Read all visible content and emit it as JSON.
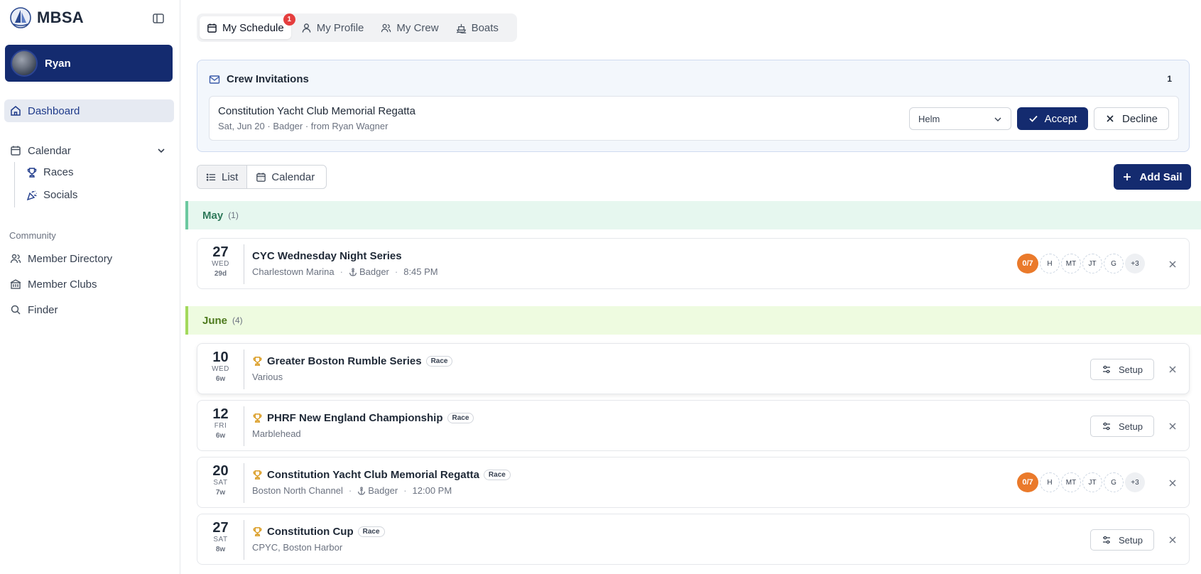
{
  "brand": {
    "name": "MBSA"
  },
  "user": {
    "name": "Ryan"
  },
  "sidebar": {
    "dashboard": "Dashboard",
    "calendar": "Calendar",
    "races": "Races",
    "socials": "Socials",
    "community_label": "Community",
    "member_directory": "Member Directory",
    "member_clubs": "Member Clubs",
    "finder": "Finder"
  },
  "tabs": {
    "schedule": "My Schedule",
    "schedule_badge": "1",
    "profile": "My Profile",
    "crew": "My Crew",
    "boats": "Boats"
  },
  "invitations": {
    "title": "Crew Invitations",
    "count": "1",
    "item": {
      "event": "Constitution Yacht Club Memorial Regatta",
      "details": "Sat, Jun 20 · Badger · from Ryan Wagner",
      "role": "Helm",
      "accept": "Accept",
      "decline": "Decline"
    }
  },
  "view": {
    "list": "List",
    "calendar": "Calendar",
    "add_sail": "Add Sail"
  },
  "months": {
    "may": {
      "name": "May",
      "count": "(1)"
    },
    "june": {
      "name": "June",
      "count": "(4)"
    }
  },
  "events": [
    {
      "day": "27",
      "dow": "WED",
      "rel": "29d",
      "title": "CYC Wednesday Night Series",
      "location": "Charlestown Marina",
      "boat": "Badger",
      "time": "8:45 PM",
      "crew_count": "0/7",
      "roles": [
        "H",
        "MT",
        "JT",
        "G"
      ],
      "more": "+3"
    },
    {
      "day": "10",
      "dow": "WED",
      "rel": "6w",
      "title": "Greater Boston Rumble Series",
      "tag": "Race",
      "location": "Various",
      "setup": "Setup"
    },
    {
      "day": "12",
      "dow": "FRI",
      "rel": "6w",
      "title": "PHRF New England Championship",
      "tag": "Race",
      "location": "Marblehead",
      "setup": "Setup"
    },
    {
      "day": "20",
      "dow": "SAT",
      "rel": "7w",
      "title": "Constitution Yacht Club Memorial Regatta",
      "tag": "Race",
      "location": "Boston North Channel",
      "boat": "Badger",
      "time": "12:00 PM",
      "crew_count": "0/7",
      "roles": [
        "H",
        "MT",
        "JT",
        "G"
      ],
      "more": "+3"
    },
    {
      "day": "27",
      "dow": "SAT",
      "rel": "8w",
      "title": "Constitution Cup",
      "tag": "Race",
      "location": "CPYC, Boston Harbor",
      "setup": "Setup"
    }
  ],
  "colors": {
    "primary": "#142b6f",
    "crew_count": "#ea7a2b",
    "trophy": "#d99a1e",
    "badge": "#e53e3e"
  }
}
